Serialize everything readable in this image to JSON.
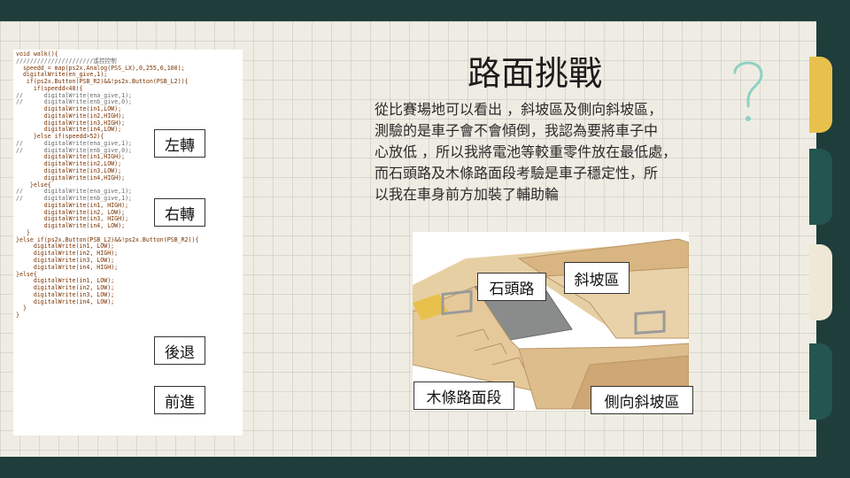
{
  "slide": {
    "title": "路面挑戰",
    "body_lines": [
      "從比賽場地可以看出 ，斜坡區及側向斜坡區，",
      "測驗的是車子會不會傾倒，我認為要將車子中",
      "心放低 ，所以我將電池等較重零件放在最低處，",
      "而石頭路及木條路面段考驗是車子穩定性，所",
      "以我在車身前方加裝了輔助輪"
    ]
  },
  "code_labels": {
    "left": "左轉",
    "right": "右轉",
    "back": "後退",
    "forward": "前進"
  },
  "track_labels": {
    "stone_road": "石頭路",
    "slope": "斜坡區",
    "wood_strip": "木條路面段",
    "side_slope": "側向斜坡區"
  },
  "code_lines": [
    "void walk(){",
    "//////////////////////遙控控制",
    "  speedd = map(ps2x.Analog(PSS_LX),0,255,0,100);",
    "  digitalWrite(en_give,1);",
    "   if(ps2x.Button(PSB_R2)&&!ps2x.Button(PSB_L2)){",
    "     if(speedd<48){",
    "//      digitalWrite(ena_give,1);",
    "//      digitalWrite(enb_give,0);",
    "        digitalWrite(in1,LOW);",
    "        digitalWrite(in2,HIGH);",
    "        digitalWrite(in3,HIGH);",
    "        digitalWrite(in4,LOW);",
    "     }else if(speedd>52){",
    "//      digitalWrite(ena_give,1);",
    "//      digitalWrite(enb_give,0);",
    "        digitalWrite(in1,HIGH);",
    "        digitalWrite(in2,LOW);",
    "        digitalWrite(in3,LOW);",
    "        digitalWrite(in4,HIGH);",
    "    }else{",
    "//      digitalWrite(ena_give,1);",
    "//      digitalWrite(enb_give,1);",
    "        digitalWrite(in1, HIGH);",
    "        digitalWrite(in2, LOW);",
    "        digitalWrite(in3, HIGH);",
    "        digitalWrite(in4, LOW);",
    "   }",
    "}else if(ps2x.Button(PSB_L2)&&!ps2x.Button(PSB_R2)){",
    "     digitalWrite(in1, LOW);",
    "     digitalWrite(in2, HIGH);",
    "     digitalWrite(in3, LOW);",
    "     digitalWrite(in4, HIGH);",
    "}else{",
    "     digitalWrite(in1, LOW);",
    "     digitalWrite(in2, LOW);",
    "     digitalWrite(in3, LOW);",
    "     digitalWrite(in4, LOW);",
    "  }",
    "}"
  ],
  "theme": {
    "frame": "#1f3d3a",
    "paper": "#efede3",
    "tab_colors": [
      "#e8c14c",
      "#245550",
      "#efe8d6",
      "#245550"
    ],
    "question_mark_color": "#8fd0c4"
  },
  "icons": {
    "question": "question-mark-icon"
  }
}
